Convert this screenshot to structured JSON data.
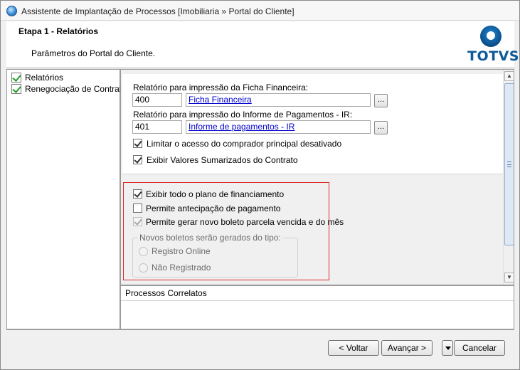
{
  "window": {
    "title": "Assistente de Implantação de Processos [Imobiliaria » Portal do Cliente]"
  },
  "header": {
    "step_title": "Etapa 1 - Relatórios",
    "subtitle": "Parâmetros do Portal do Cliente.",
    "logo_text": "TOTVS"
  },
  "tree": {
    "items": [
      {
        "label": "Relatórios",
        "icon": "green-check-icon"
      },
      {
        "label": "Renegociação de Contrato",
        "icon": "green-check-icon"
      }
    ]
  },
  "form": {
    "ficha": {
      "label": "Relatório para impressão da Ficha Financeira:",
      "code": "400",
      "name": "Ficha Financeira",
      "browse": "..."
    },
    "informe": {
      "label": "Relatório para impressão do Informe de Pagamentos - IR:",
      "code": "401",
      "name": "Informe de pagamentos - IR",
      "browse": "..."
    },
    "checkboxes_top": [
      {
        "label": "Limitar o acesso do comprador principal desativado",
        "checked": true
      },
      {
        "label": "Exibir Valores Sumarizados do Contrato",
        "checked": true
      }
    ],
    "checkboxes_financing": [
      {
        "label": "Exibir todo o plano de financiamento",
        "checked": true,
        "enabled": true
      },
      {
        "label": "Permite antecipação de pagamento",
        "checked": false,
        "enabled": true
      },
      {
        "label": "Permite gerar novo boleto parcela vencida e do mês",
        "checked": true,
        "enabled": false
      }
    ],
    "group": {
      "legend": "Novos boletos serão gerados do tipo:",
      "options": [
        {
          "label": "Registro Online",
          "selected": false
        },
        {
          "label": "Não Registrado",
          "selected": false
        }
      ]
    }
  },
  "related": {
    "header": "Processos Correlatos"
  },
  "footer": {
    "back": "< Voltar",
    "next": "Avançar >",
    "cancel": "Cancelar"
  },
  "colors": {
    "highlight_border": "#d92b2b",
    "logo_blue": "#0c5a98",
    "link_blue": "#0000cc"
  }
}
